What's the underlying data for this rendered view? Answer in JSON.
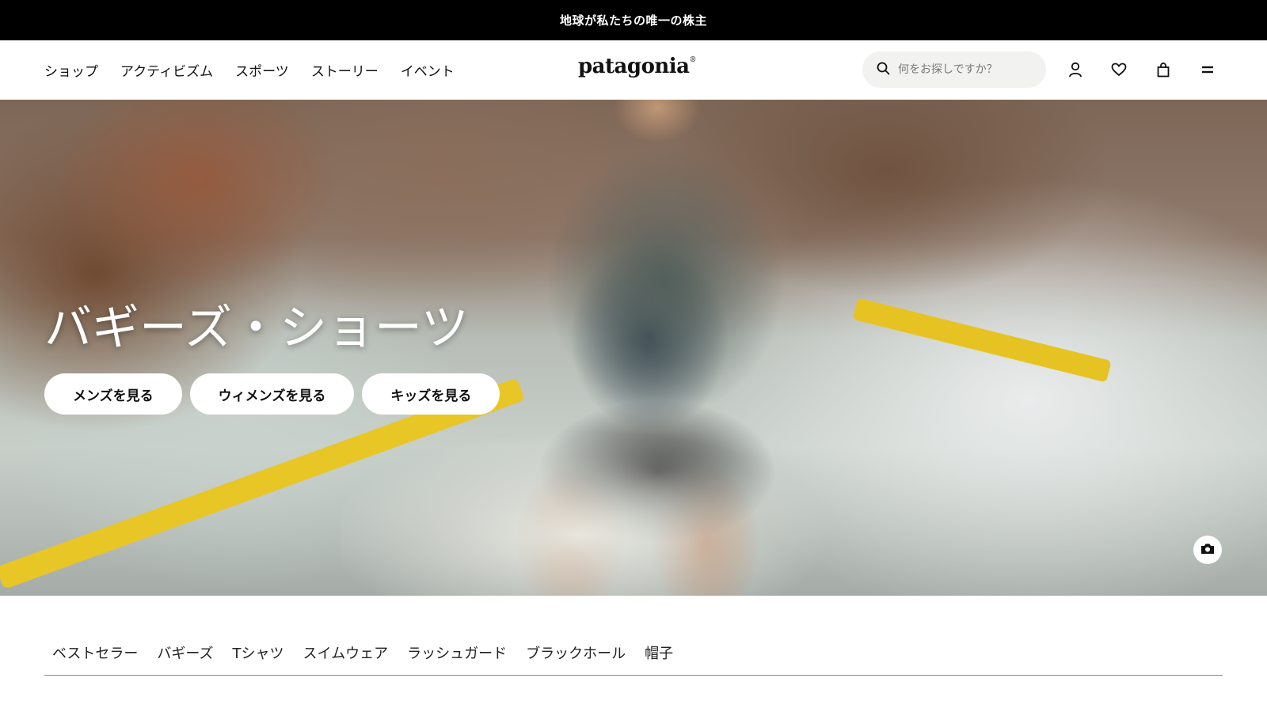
{
  "announcement": "地球が私たちの唯一の株主",
  "nav": {
    "items": [
      {
        "label": "ショップ"
      },
      {
        "label": "アクティビズム"
      },
      {
        "label": "スポーツ"
      },
      {
        "label": "ストーリー"
      },
      {
        "label": "イベント"
      }
    ]
  },
  "logo": {
    "text": "patagonia",
    "mark": "®"
  },
  "search": {
    "placeholder": "何をお探しですか？",
    "value": ""
  },
  "header_icons": [
    "search-icon",
    "account-icon",
    "heart-icon",
    "bag-icon",
    "menu-icon"
  ],
  "hero": {
    "title": "バギーズ・ショーツ",
    "buttons": [
      {
        "label": "メンズを見る"
      },
      {
        "label": "ウィメンズを見る"
      },
      {
        "label": "キッズを見る"
      }
    ],
    "camera_icon": "camera-icon"
  },
  "categories": [
    {
      "label": "ベストセラー"
    },
    {
      "label": "バギーズ"
    },
    {
      "label": "Tシャツ"
    },
    {
      "label": "スイムウェア"
    },
    {
      "label": "ラッシュガード"
    },
    {
      "label": "ブラックホール"
    },
    {
      "label": "帽子"
    }
  ],
  "colors": {
    "announcement_bg": "#000000",
    "oar": "#e6c322",
    "text": "#111111"
  }
}
